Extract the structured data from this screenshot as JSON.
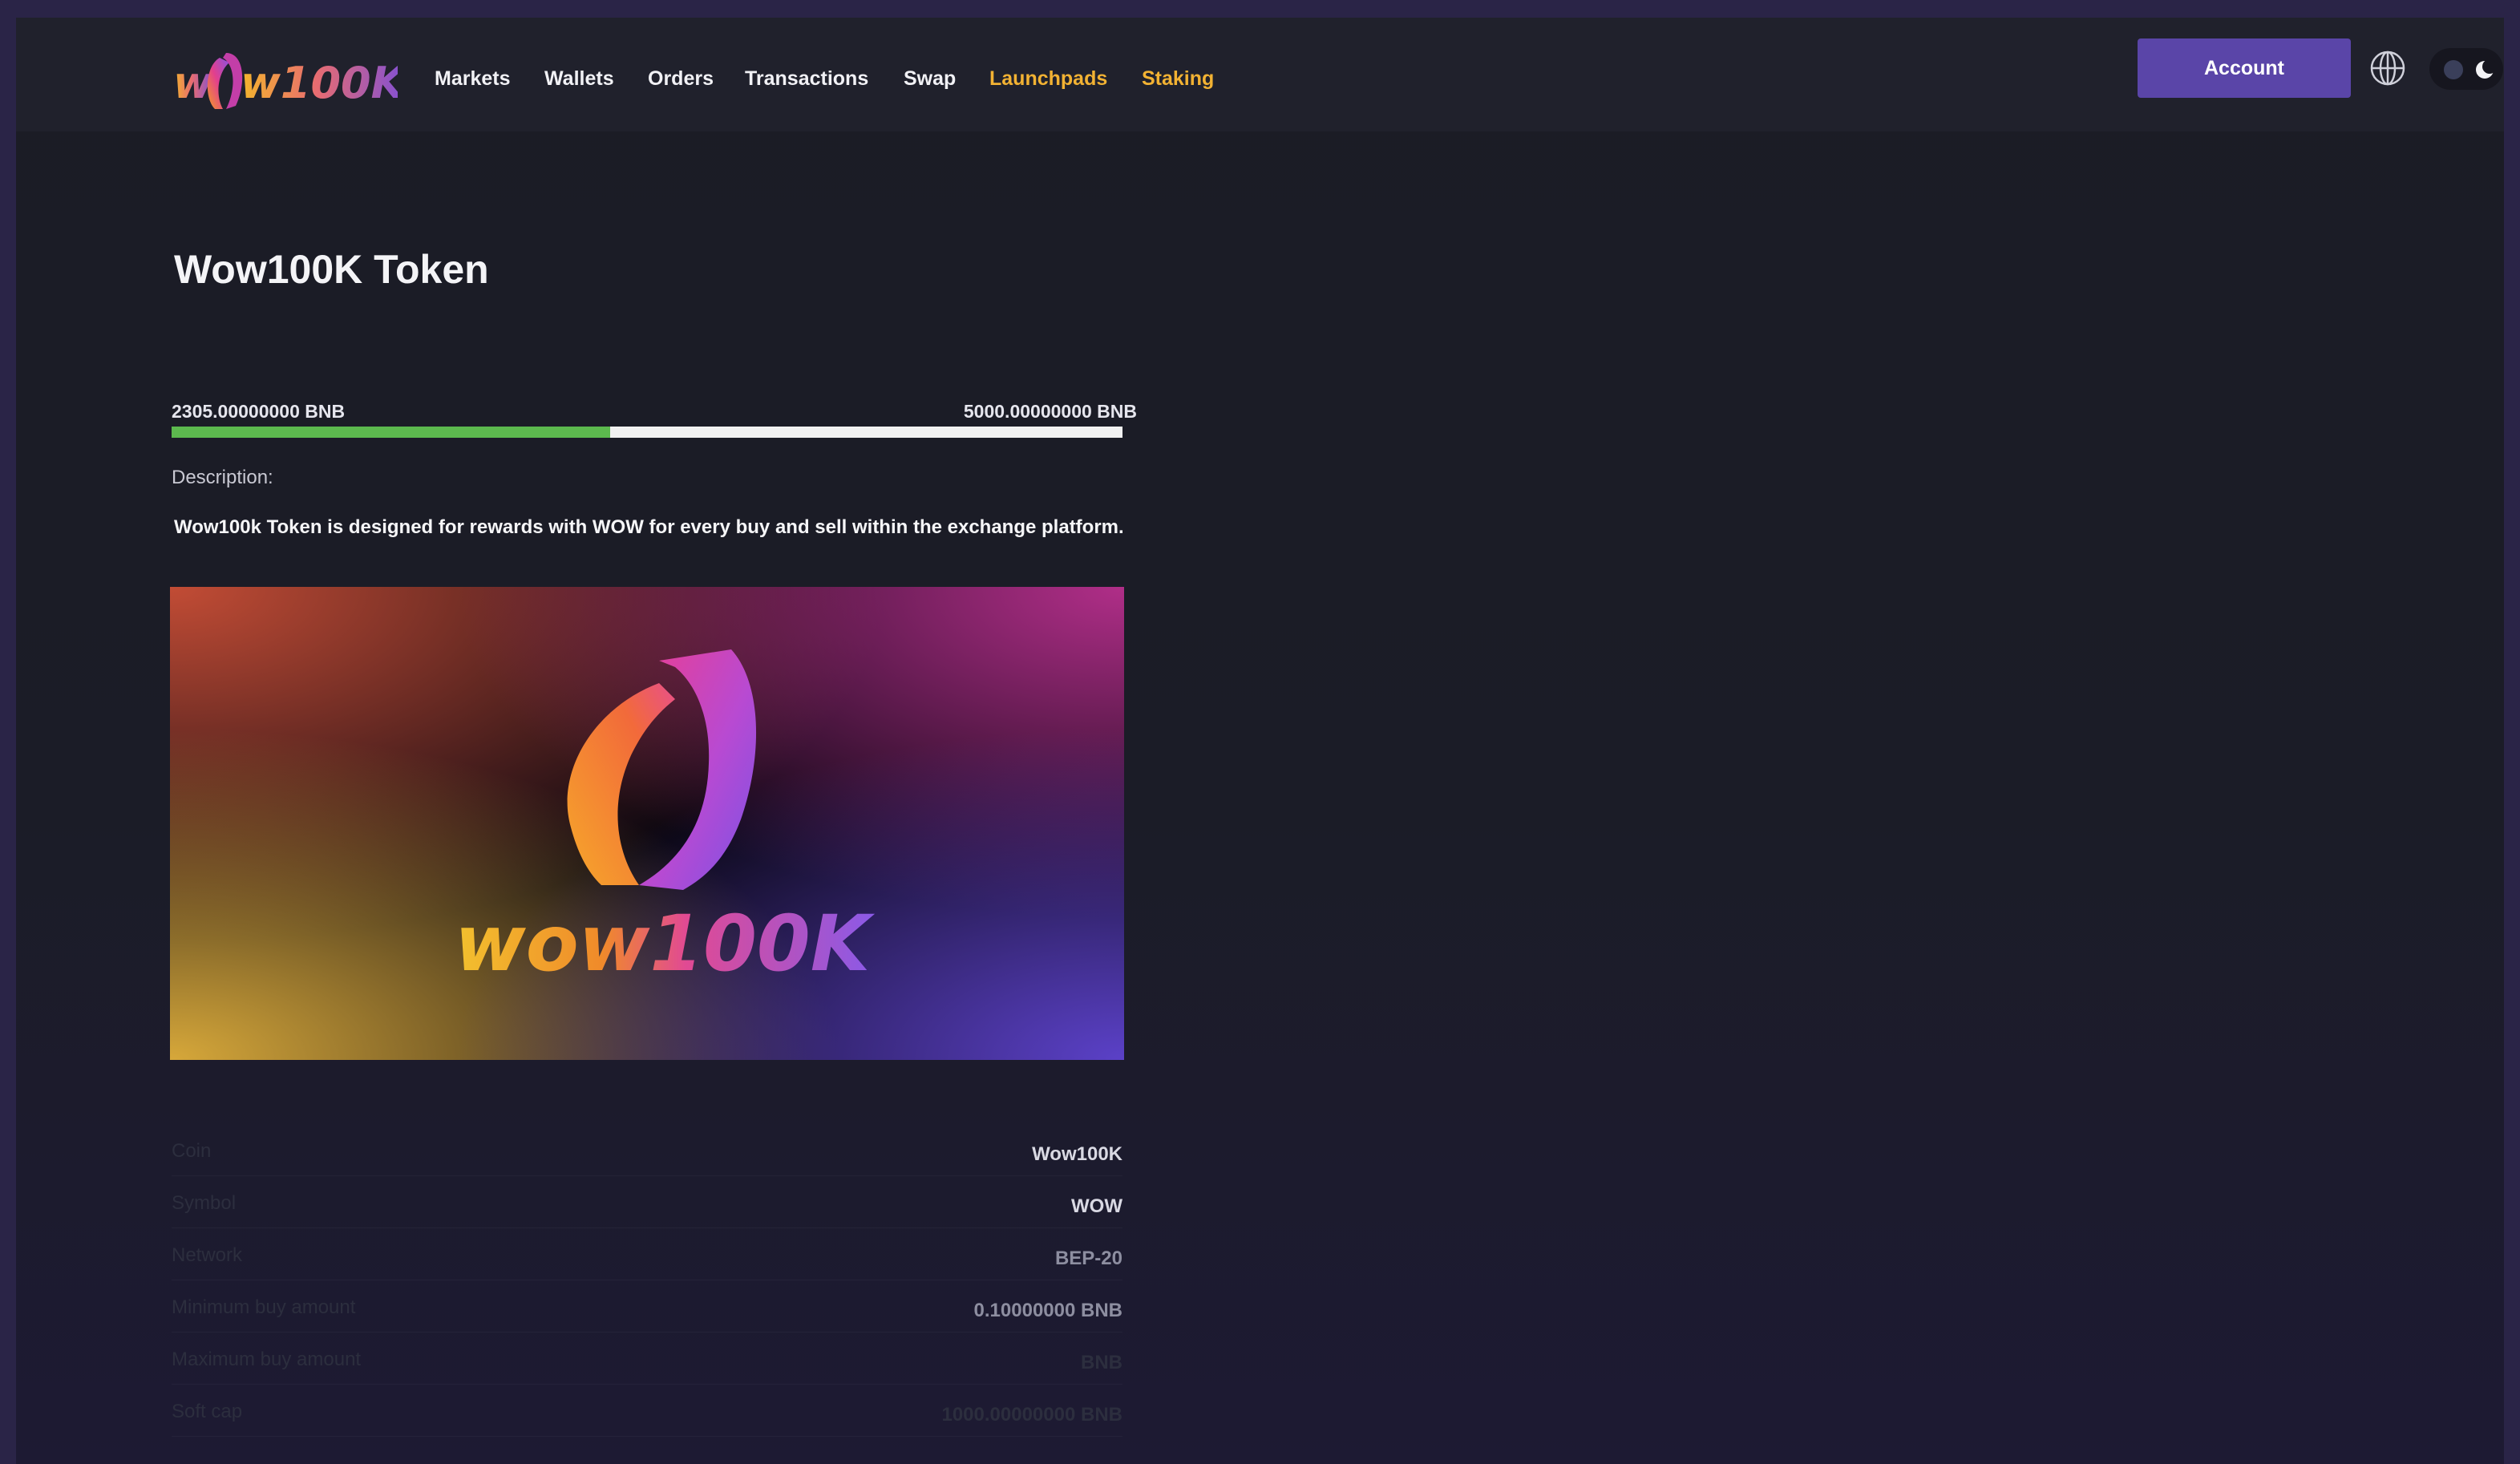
{
  "nav": {
    "logo_text": "wow100K",
    "items": [
      {
        "label": "Markets",
        "accent": false
      },
      {
        "label": "Wallets",
        "accent": false
      },
      {
        "label": "Orders",
        "accent": false
      },
      {
        "label": "Transactions",
        "accent": false
      },
      {
        "label": "Swap",
        "accent": false
      },
      {
        "label": "Launchpads",
        "accent": true
      },
      {
        "label": "Staking",
        "accent": true
      }
    ],
    "account_label": "Account",
    "globe_icon": "globe-icon",
    "theme_icon": "moon-icon"
  },
  "colors": {
    "accent": "#f2b233",
    "button": "#5a45a8",
    "progress_fill": "#5cb94e"
  },
  "token": {
    "title": "Wow100K Token",
    "raised": "2305.00000000 BNB",
    "goal": "5000.00000000 BNB",
    "progress_fraction": 0.461,
    "description_label": "Description:",
    "description": "Wow100k Token is designed for rewards with WOW for every buy and sell within the  exchange platform.",
    "banner_logo_text": "wow100K"
  },
  "details": [
    {
      "key": "Coin",
      "value": "Wow100K"
    },
    {
      "key": "Symbol",
      "value": "WOW"
    },
    {
      "key": "Network",
      "value": "BEP-20"
    },
    {
      "key": "Minimum buy amount",
      "value": "0.10000000 BNB"
    },
    {
      "key": "Maximum buy amount",
      "value": "BNB"
    },
    {
      "key": "Soft cap",
      "value": "1000.00000000 BNB"
    }
  ]
}
